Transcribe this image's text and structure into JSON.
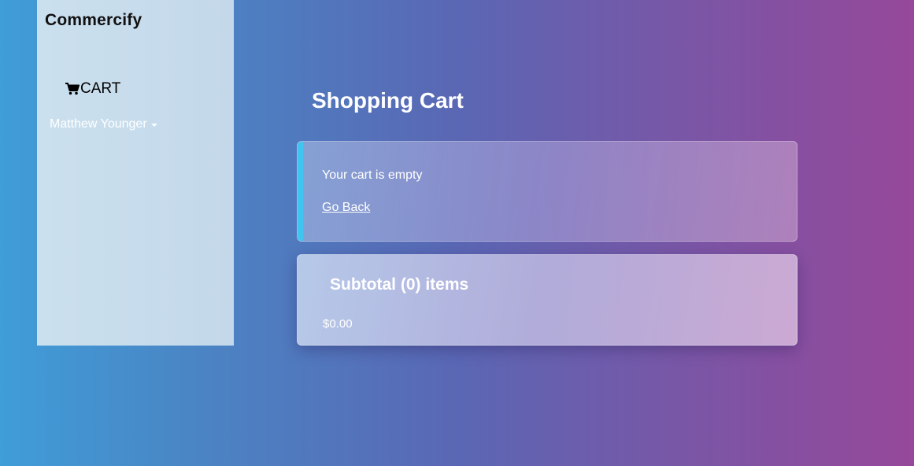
{
  "brand": "Commercify",
  "nav": {
    "cart_label": "CART",
    "cart_icon": "shopping-cart-icon",
    "user_name": "Matthew Younger",
    "user_dropdown_icon": "caret-down-icon"
  },
  "main": {
    "title": "Shopping Cart",
    "empty_message": "Your cart is empty",
    "go_back_label": "Go Back",
    "subtotal_heading": "Subtotal (0) items",
    "subtotal_amount": "$0.00"
  },
  "colors": {
    "accent": "#3fc5f0",
    "gradient_start": "#3f9dd8",
    "gradient_end": "#96489a"
  }
}
